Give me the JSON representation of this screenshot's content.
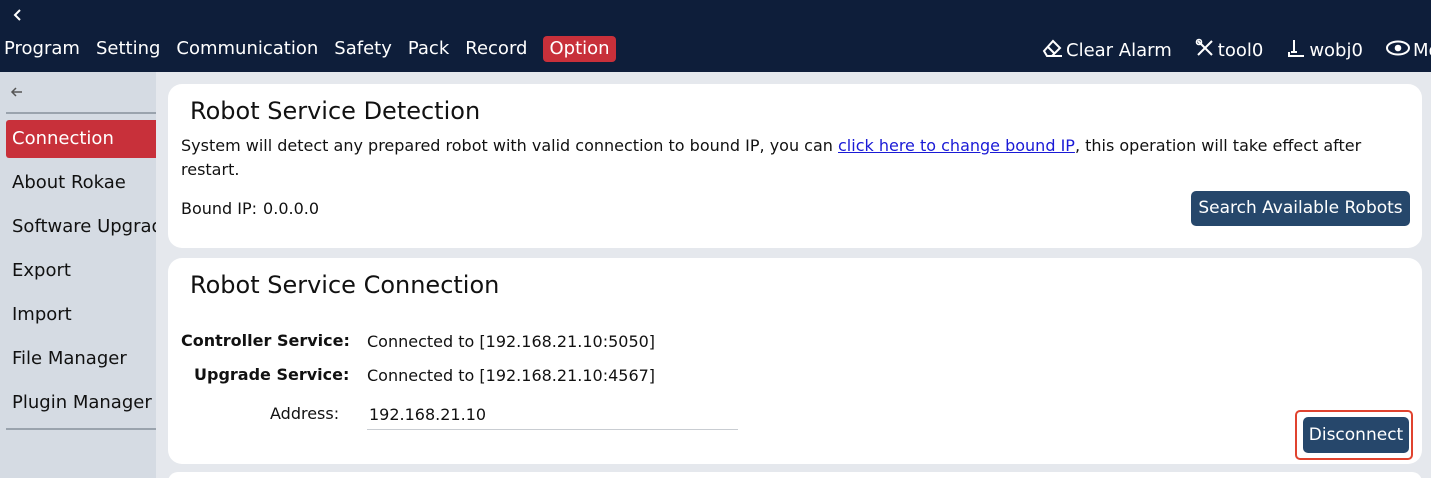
{
  "topbar": {
    "menu": [
      "Program",
      "Setting",
      "Communication",
      "Safety",
      "Pack",
      "Record",
      "Option"
    ],
    "active_menu": "Option",
    "tools": [
      {
        "label": "Clear Alarm",
        "icon": "eraser-icon"
      },
      {
        "label": "tool0",
        "icon": "tool-icon"
      },
      {
        "label": "wobj0",
        "icon": "wobj-icon"
      },
      {
        "label": "Mo",
        "icon": "eye-icon"
      }
    ]
  },
  "sidebar": {
    "items": [
      "Connection",
      "About Rokae",
      "Software Upgrade",
      "Export",
      "Import",
      "File Manager",
      "Plugin Manager"
    ],
    "active": "Connection"
  },
  "detection": {
    "title": "Robot Service Detection",
    "desc_before": "System will detect any prepared robot with valid connection to bound IP, you can ",
    "desc_link": "click here to change bound IP",
    "desc_after": ", this operation will take effect after restart.",
    "bound_label": "Bound IP:",
    "bound_value": "0.0.0.0",
    "search_button": "Search Available Robots"
  },
  "connection": {
    "title": "Robot Service Connection",
    "controller_label": "Controller Service:",
    "controller_value": "Connected to [192.168.21.10:5050]",
    "upgrade_label": "Upgrade Service:",
    "upgrade_value": "Connected to [192.168.21.10:4567]",
    "address_label": "Address:",
    "address_value": "192.168.21.10",
    "disconnect_button": "Disconnect"
  },
  "colors": {
    "topbar": "#0e1e3a",
    "accent": "#c8303a",
    "button": "#26476b",
    "highlight_border": "#e0432f",
    "link": "#1a1ad6"
  }
}
